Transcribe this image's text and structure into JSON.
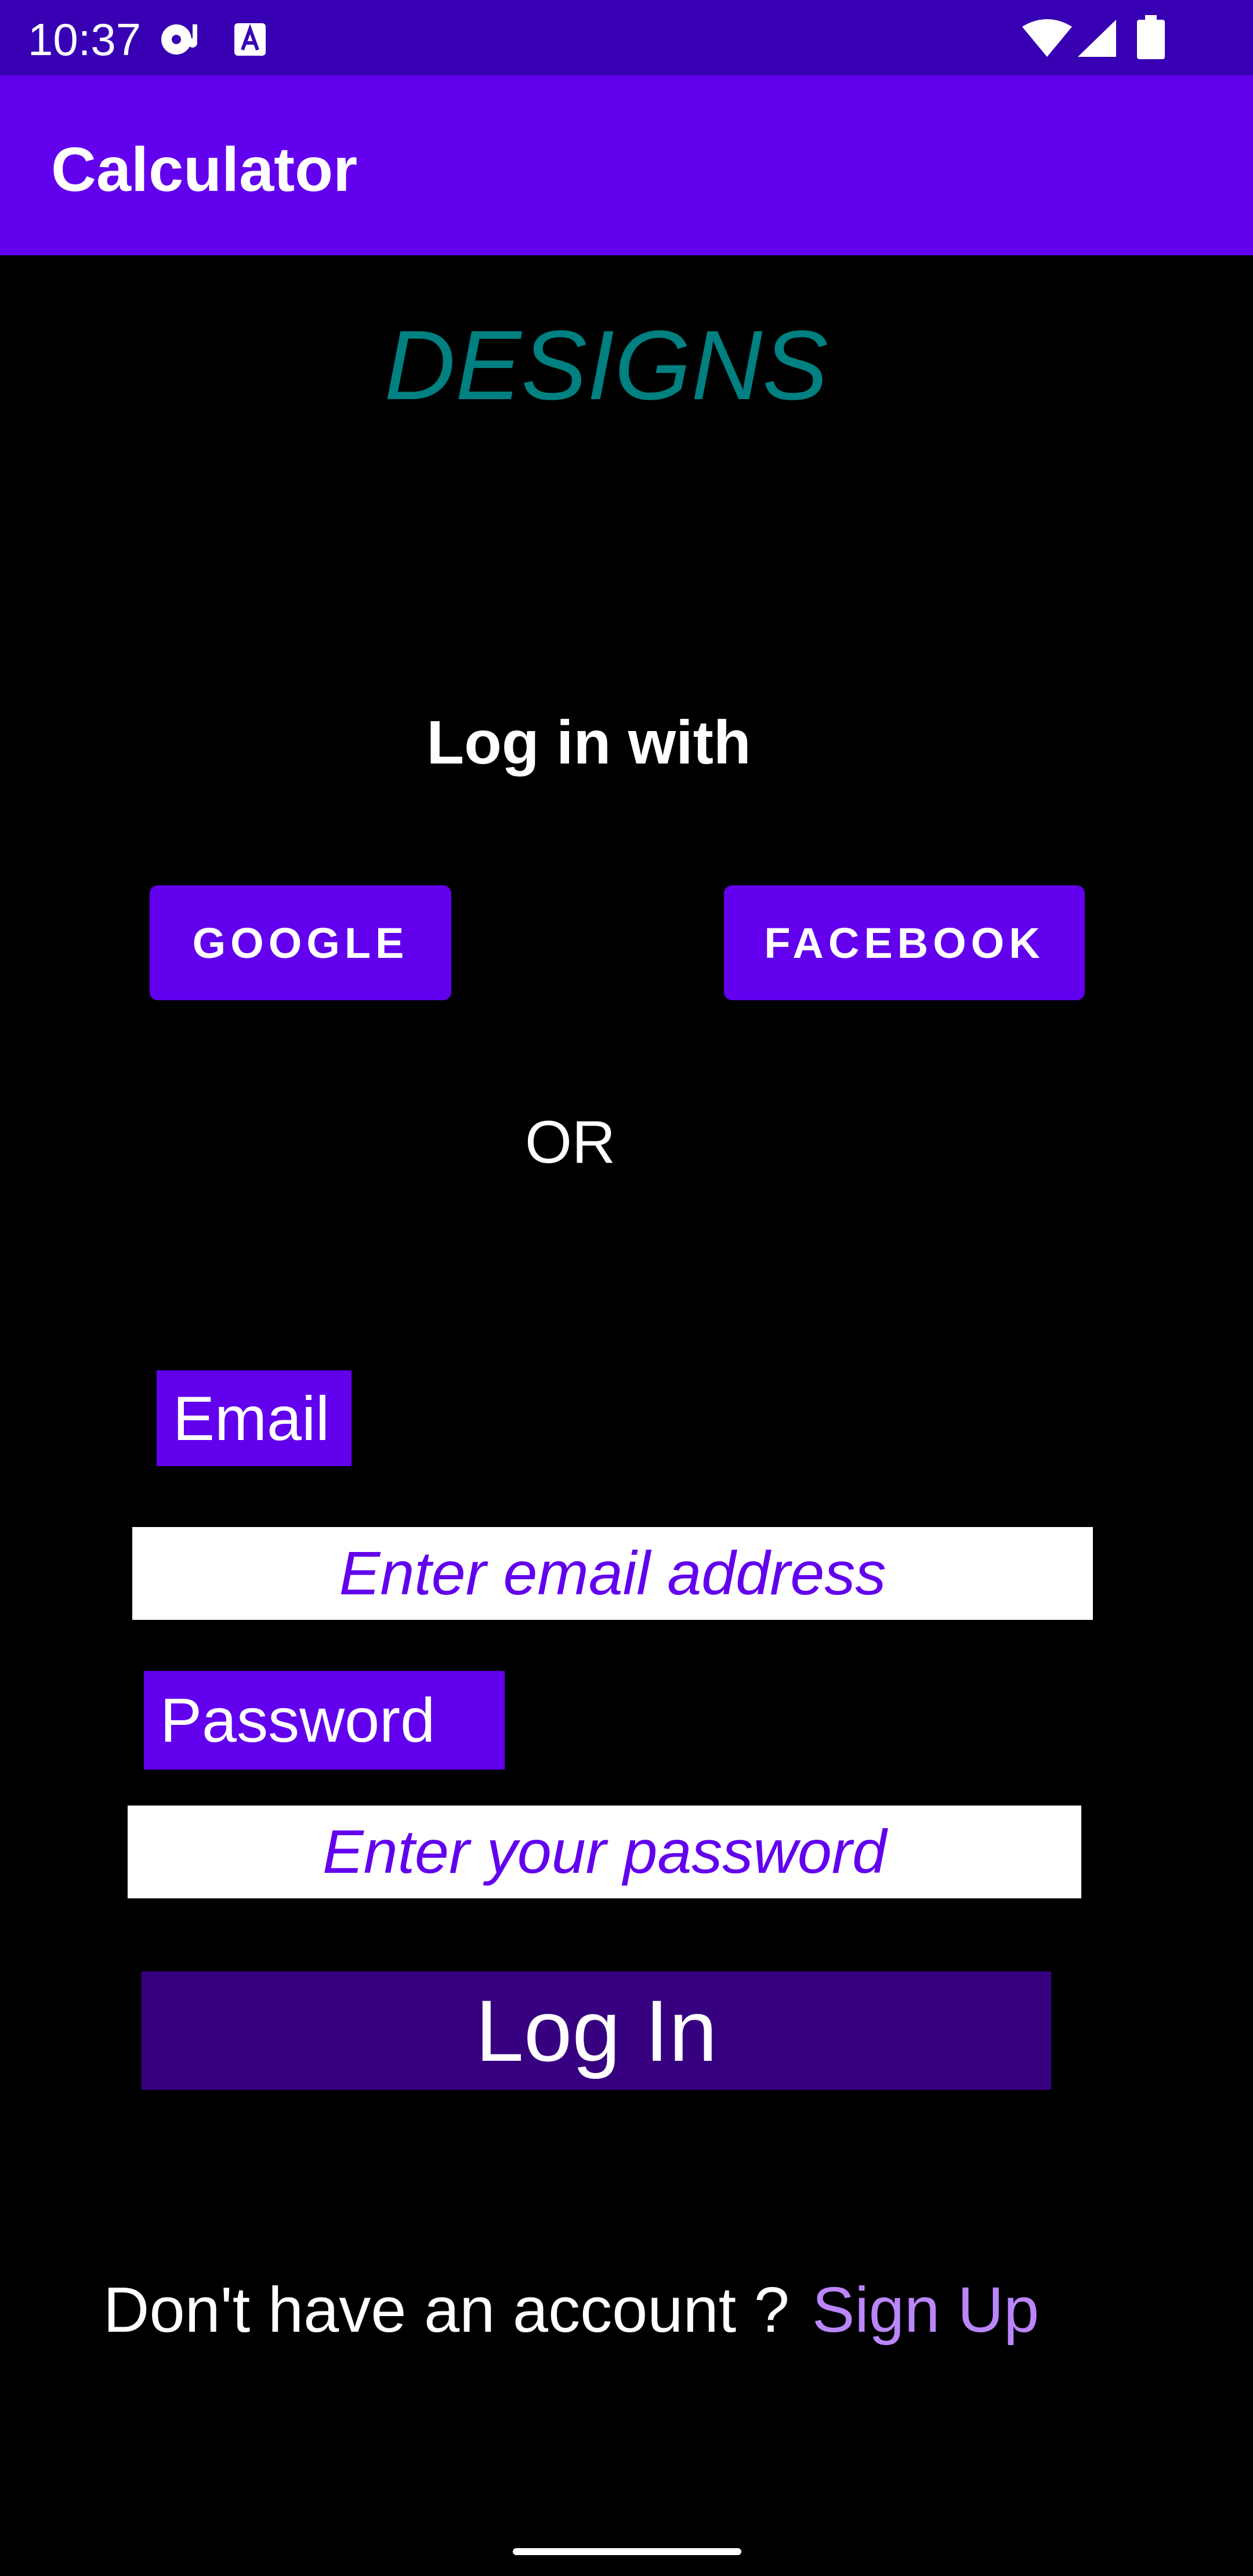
{
  "status_bar": {
    "time": "10:37",
    "icons": [
      "media-icon",
      "text-a-icon",
      "wifi-icon",
      "signal-icon",
      "battery-icon"
    ],
    "color": "#3700B3"
  },
  "app_bar": {
    "title": "Calculator",
    "color": "#6200EE"
  },
  "main": {
    "designs_title": "DESIGNS",
    "login_with": "Log in with",
    "google_label": "GOOGLE",
    "facebook_label": "FACEBOOK",
    "or_text": "OR",
    "email_label": "Email",
    "email_placeholder": "Enter email address",
    "password_label": "Password",
    "password_placeholder": "Enter your password",
    "login_button": "Log In",
    "signup_prompt": "Don't have an account ?",
    "signup_link": "Sign Up"
  },
  "colors": {
    "accent": "#6200EE",
    "dark_accent": "#370080",
    "designs_teal": "#008080",
    "link": "#BB86FC",
    "background": "#000000"
  }
}
